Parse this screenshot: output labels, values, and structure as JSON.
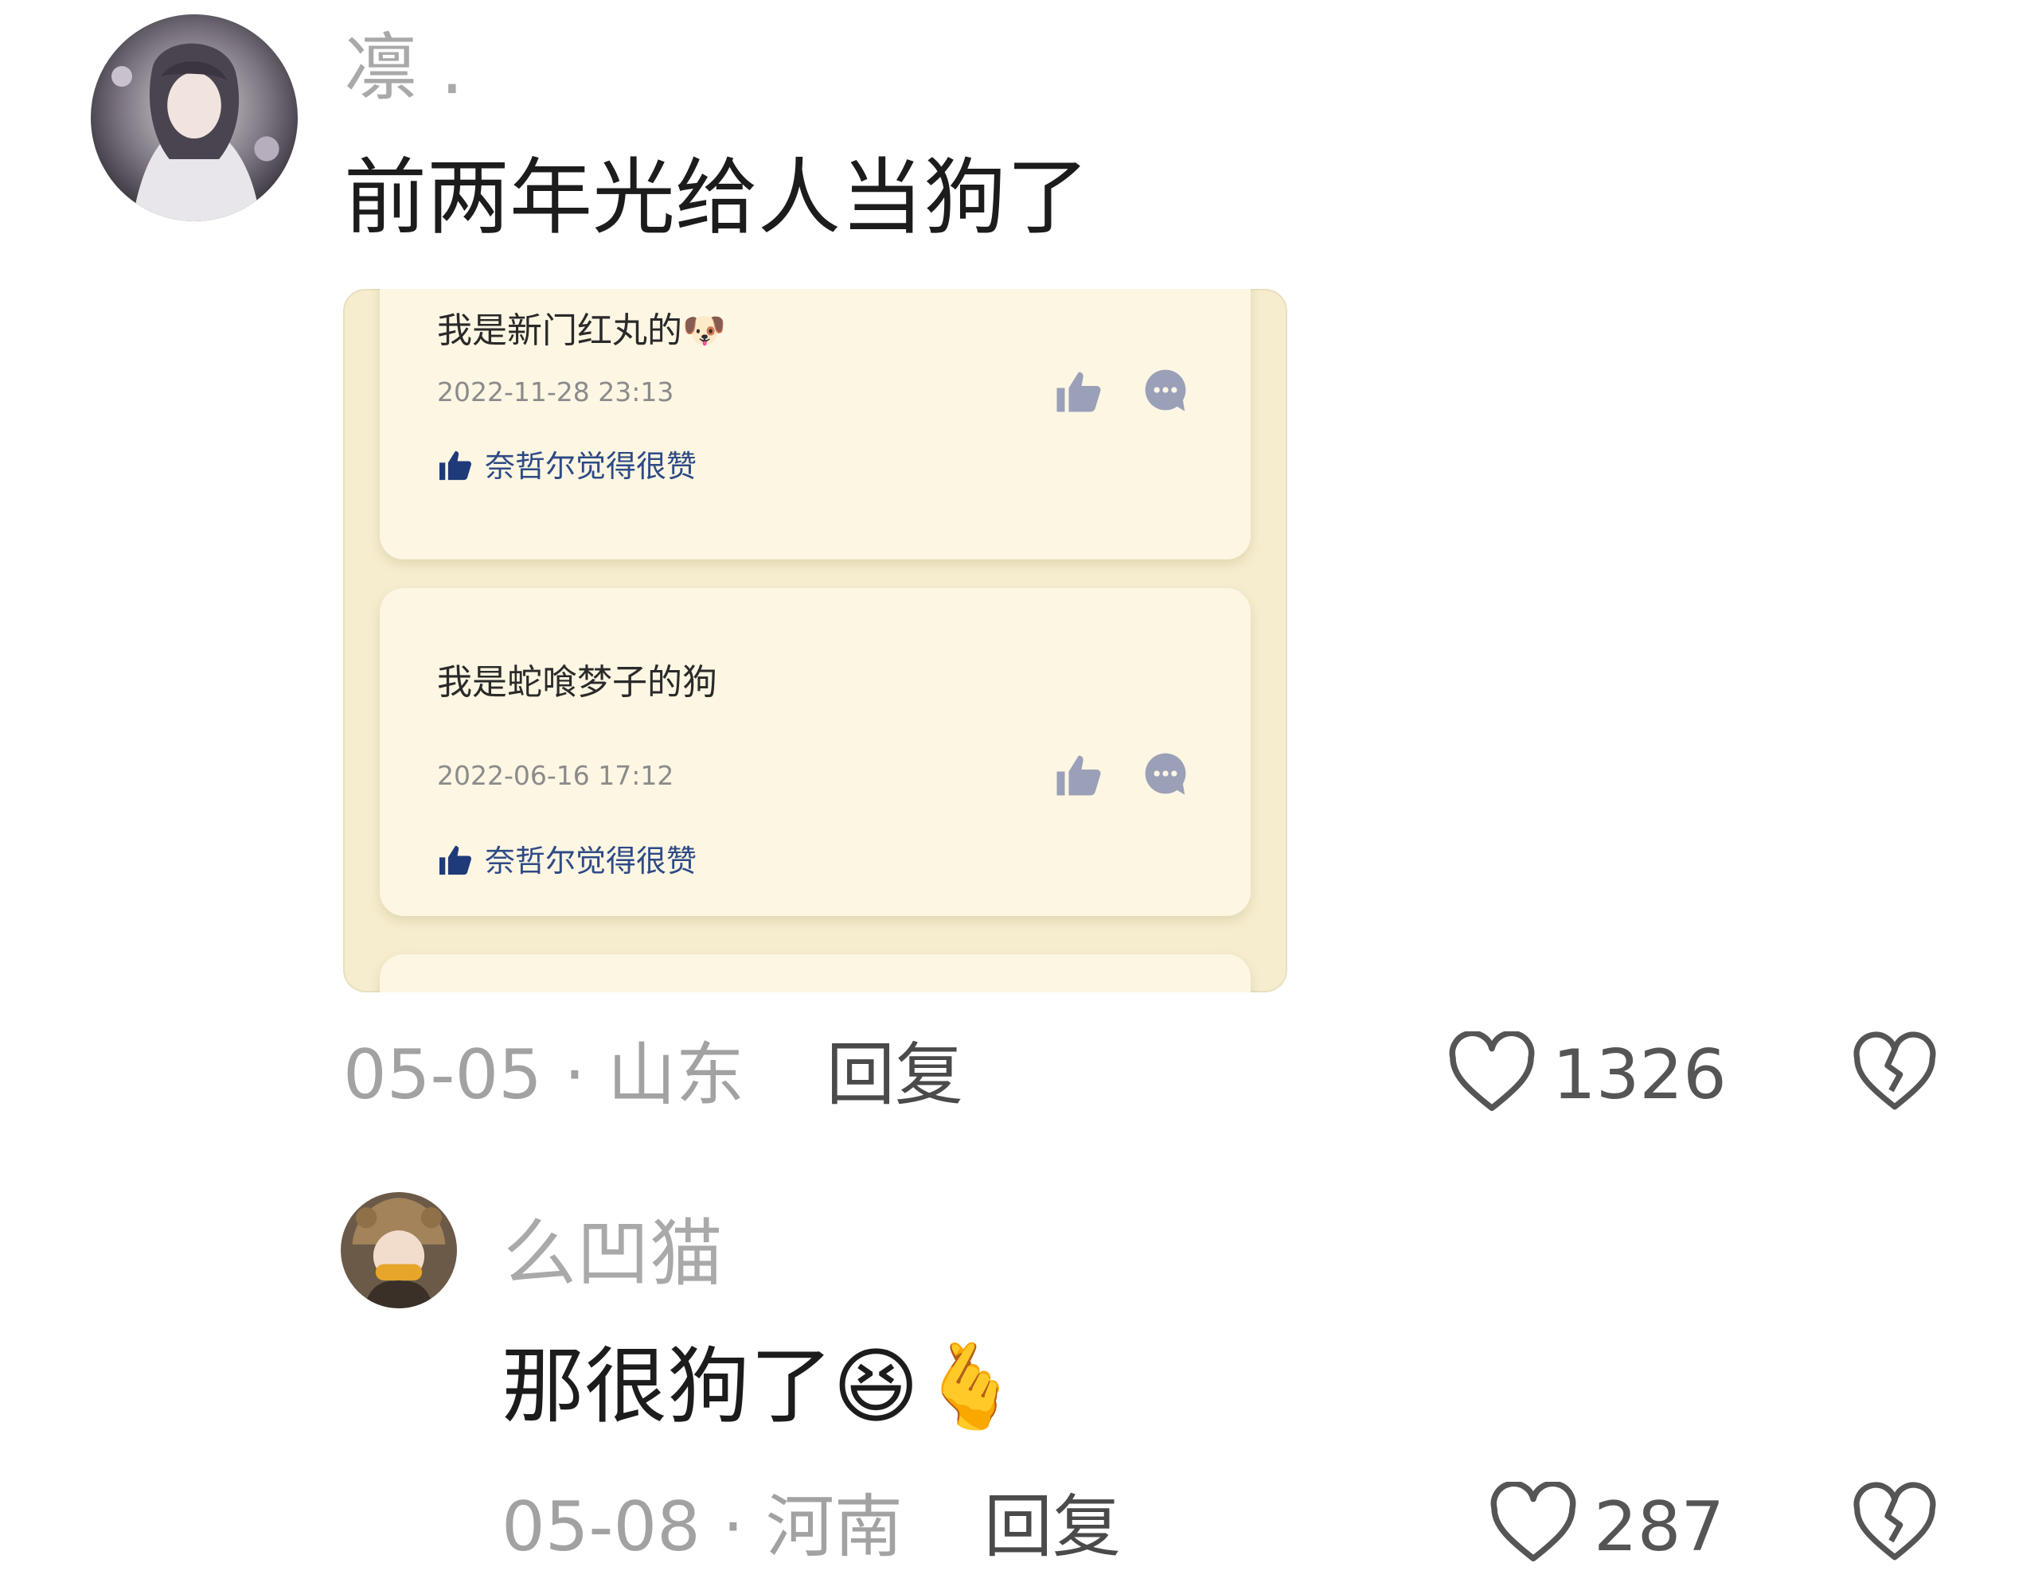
{
  "comments": [
    {
      "username": "凛 .",
      "text": "前两年光给人当狗了",
      "date": "05-05",
      "location": "山东",
      "reply_label": "回复",
      "like_count": "1326",
      "embedded_screenshot": {
        "cards": [
          {
            "text": "我是新门红丸的🐶",
            "time": "2022-11-28 23:13",
            "liked_by": "奈哲尔觉得很赞"
          },
          {
            "text": "我是蛇喰梦子的狗",
            "time": "2022-06-16 17:12",
            "liked_by": "奈哲尔觉得很赞"
          }
        ]
      }
    },
    {
      "username": "么凹猫",
      "text": "那很狗了😆🫰",
      "date": "05-08",
      "location": "河南",
      "reply_label": "回复",
      "like_count": "287"
    }
  ],
  "separator": "·",
  "icons": {
    "like": "heart-outline-icon",
    "dislike": "broken-heart-icon",
    "card_like": "thumbs-up-icon",
    "card_comment": "chat-bubble-icon"
  },
  "colors": {
    "username": "#a9a9a9",
    "liked_by": "#2e4a86",
    "screenshot_bg": "#f6edcf"
  }
}
